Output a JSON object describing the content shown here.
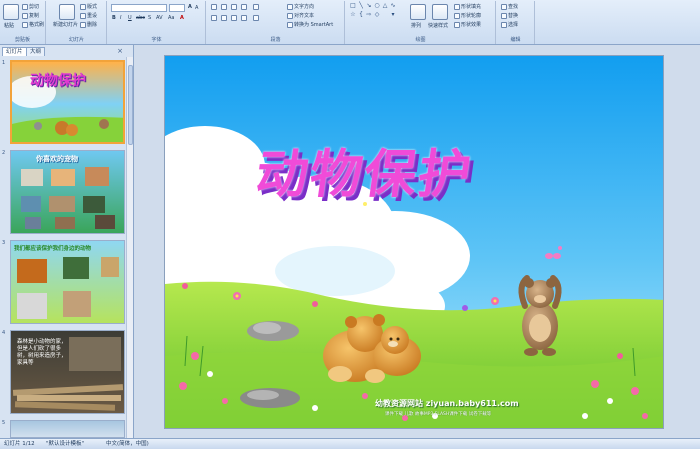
{
  "ribbon": {
    "groups": [
      {
        "label": "剪贴板",
        "items": [
          "粘贴",
          "剪切",
          "复制",
          "格式刷"
        ]
      },
      {
        "label": "幻灯片",
        "items": [
          "新建幻灯片",
          "版式",
          "重设",
          "删除"
        ]
      },
      {
        "label": "字体",
        "items": [
          "B",
          "I",
          "U",
          "abc",
          "S",
          "AV",
          "Aa",
          "A"
        ]
      },
      {
        "label": "段落",
        "items": [
          "文字方向",
          "对齐文本",
          "转换为 SmartArt"
        ]
      },
      {
        "label": "绘图",
        "items": [
          "排列",
          "快速样式",
          "形状填充",
          "形状轮廓",
          "形状效果"
        ]
      },
      {
        "label": "编辑",
        "items": [
          "查找",
          "替换",
          "选择"
        ]
      }
    ]
  },
  "panel": {
    "tabs": [
      "幻灯片",
      "大纲"
    ],
    "close": "×",
    "slides": [
      {
        "number": "1",
        "caption": "动物保护"
      },
      {
        "number": "2",
        "caption": "你喜欢的宠物"
      },
      {
        "number": "3",
        "caption": "我们都应该保护我们身边的动物"
      },
      {
        "number": "4",
        "caption": "森林是小动物的家，但是人们砍了很多树，树用来造房子，家具等"
      },
      {
        "number": "5",
        "caption": ""
      }
    ]
  },
  "slide": {
    "title": "动物保护",
    "footer_main": "幼教资源网站  ziyuan.baby611.com",
    "footer_sub": "课件下载  儿歌  故事MP3  FLASH课件下载  试卷下载等"
  },
  "status": {
    "slide_count": "幻灯片 1/12",
    "theme": "\"默认设计模板\"",
    "language": "中文(简体，中国)"
  },
  "colors": {
    "sky_top": "#1aa3f0",
    "grass": "#7ccf2a",
    "title_pink": "#e83ad8",
    "selected_border": "#f2a33a"
  }
}
